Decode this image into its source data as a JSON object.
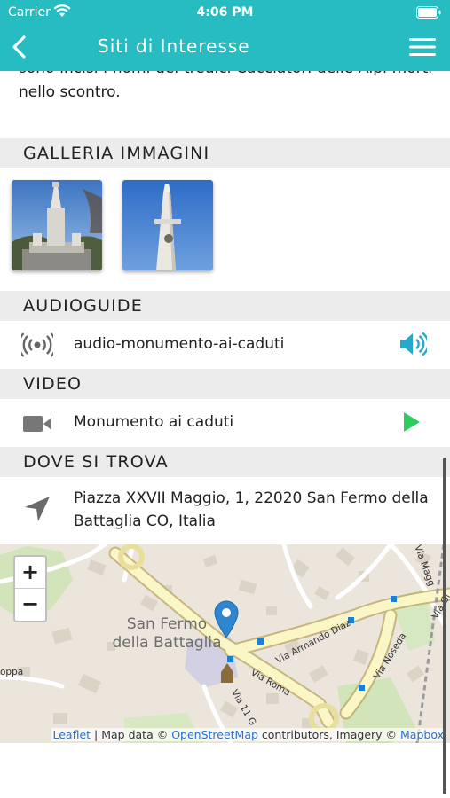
{
  "status_bar": {
    "carrier": "Carrier",
    "time": "4:06 PM"
  },
  "nav": {
    "title": "Siti di Interesse"
  },
  "description": {
    "text": "sono incisi i nomi dei tredici Cacciatori delle Alpi morti nello scontro."
  },
  "gallery": {
    "title": "GALLERIA IMMAGINI"
  },
  "audioguide": {
    "title": "AUDIOGUIDE",
    "item_label": "audio-monumento-ai-caduti"
  },
  "video": {
    "title": "VIDEO",
    "item_label": "Monumento ai caduti"
  },
  "location": {
    "title": "DOVE SI TROVA",
    "address": "Piazza XXVII Maggio, 1, 22020 San Fermo della Battaglia CO, Italia"
  },
  "map": {
    "zoom_in": "+",
    "zoom_out": "−",
    "place_label_line1": "San Fermo",
    "place_label_line2": "della Battaglia",
    "streets": [
      "Via Armando Diaz",
      "Via Roma",
      "Via Noseda",
      "Via Magg",
      "Via Gi",
      "Via 11 G",
      "oppa"
    ],
    "attribution": {
      "leaflet": "Leaflet",
      "map_data": " | Map data © ",
      "osm": "OpenStreetMap",
      "contributors": " contributors, Imagery © ",
      "mapbox": "Mapbox"
    }
  },
  "colors": {
    "accent": "#26bcc1",
    "play": "#2ecc5f",
    "section_bg": "#ececec",
    "marker": "#2f86cf"
  }
}
